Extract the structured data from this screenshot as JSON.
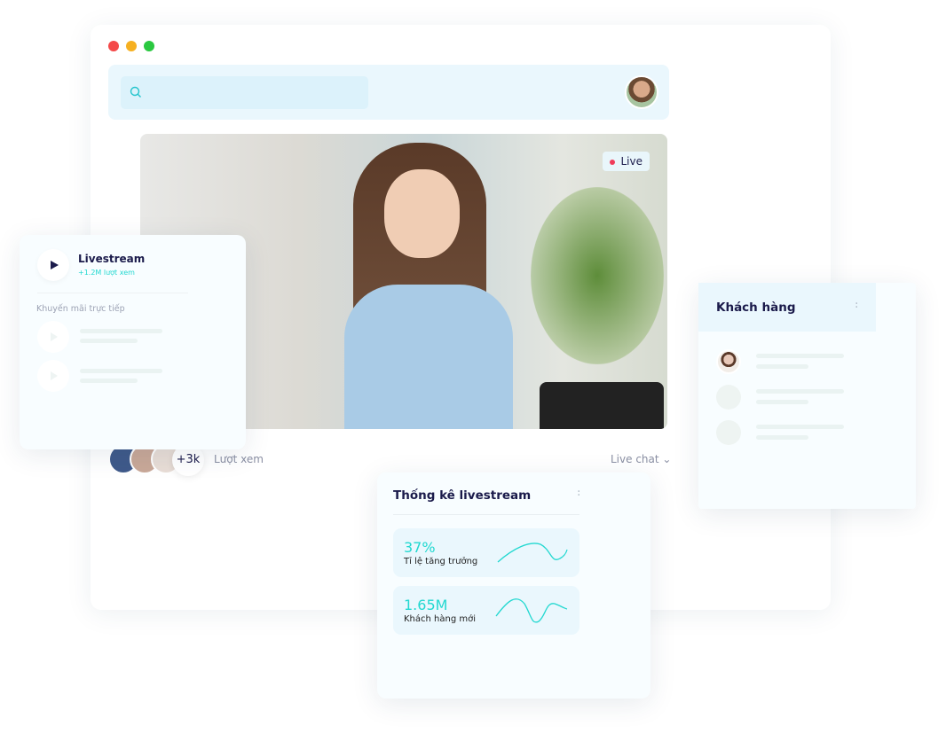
{
  "window": {
    "traffic_lights": [
      "#f44949",
      "#f6b021",
      "#2ac840"
    ]
  },
  "search": {
    "placeholder": "",
    "icon": "search-icon"
  },
  "video": {
    "live_label": "Live"
  },
  "viewers": {
    "count": "+3k",
    "label": "Lượt xem"
  },
  "live_chat": {
    "label": "Live chat"
  },
  "livestream_card": {
    "title": "Livestream",
    "subtitle": "+1.2M lượt xem",
    "section": "Khuyến mãi trực tiếp"
  },
  "customers_card": {
    "title": "Khách hàng"
  },
  "stats_card": {
    "title": "Thống kê livestream",
    "items": [
      {
        "value": "37%",
        "label": "Tỉ lệ tăng trưởng"
      },
      {
        "value": "1.65M",
        "label": "Khách hàng mới"
      }
    ]
  },
  "colors": {
    "accent": "#22d8d0",
    "navy": "#1b1b4b",
    "live": "#f03c5a"
  }
}
